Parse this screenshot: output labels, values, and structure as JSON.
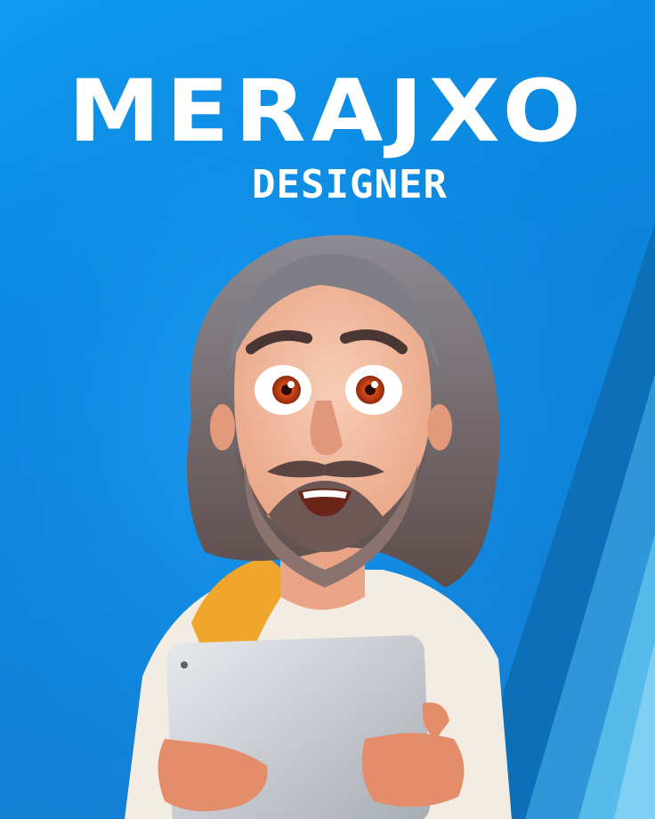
{
  "poster": {
    "title": "MERAJXO",
    "subtitle": "DESIGNER"
  },
  "colors": {
    "background": "#0a86de",
    "accent_stripe_dark": "#0d6fb8",
    "accent_stripe_light": "#4fb8ea",
    "text": "#ffffff"
  },
  "illustration": {
    "subject": "cartoon bearded man holding tablet",
    "icon": "character-illustration"
  }
}
